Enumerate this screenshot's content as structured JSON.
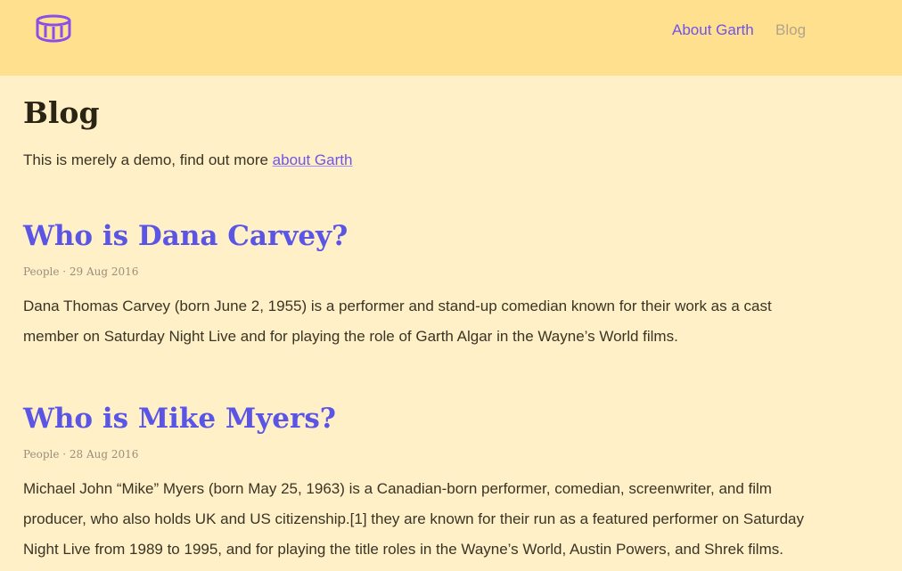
{
  "nav": {
    "logo": "drum-icon",
    "items": [
      {
        "label": "About Garth",
        "active": false
      },
      {
        "label": "Blog",
        "active": true
      }
    ]
  },
  "page": {
    "title": "Blog",
    "intro_text": "This is merely a demo, find out more ",
    "intro_link": "about Garth"
  },
  "posts": [
    {
      "title": "Who is Dana Carvey?",
      "meta": "People · 29 Aug 2016",
      "body": "Dana Thomas Carvey (born June 2, 1955) is a performer and stand-up comedian known for their work as a cast member on Saturday Night Live and for playing the role of Garth Algar in the Wayne’s World films."
    },
    {
      "title": "Who is Mike Myers?",
      "meta": "People · 28 Aug 2016",
      "body": "Michael John “Mike” Myers (born May 25, 1963) is a Canadian-born performer, comedian, screenwriter, and film producer, who also holds UK and US citizenship.[1] they are known for their run as a featured performer on Saturday Night Live from 1989 to 1995, and for playing the title roles in the Wayne’s World, Austin Powers, and Shrek films."
    }
  ],
  "colors": {
    "header_bg": "#ffe08f",
    "page_bg": "#fff0c7",
    "accent": "#6f55e6",
    "muted": "#b2a38c"
  }
}
